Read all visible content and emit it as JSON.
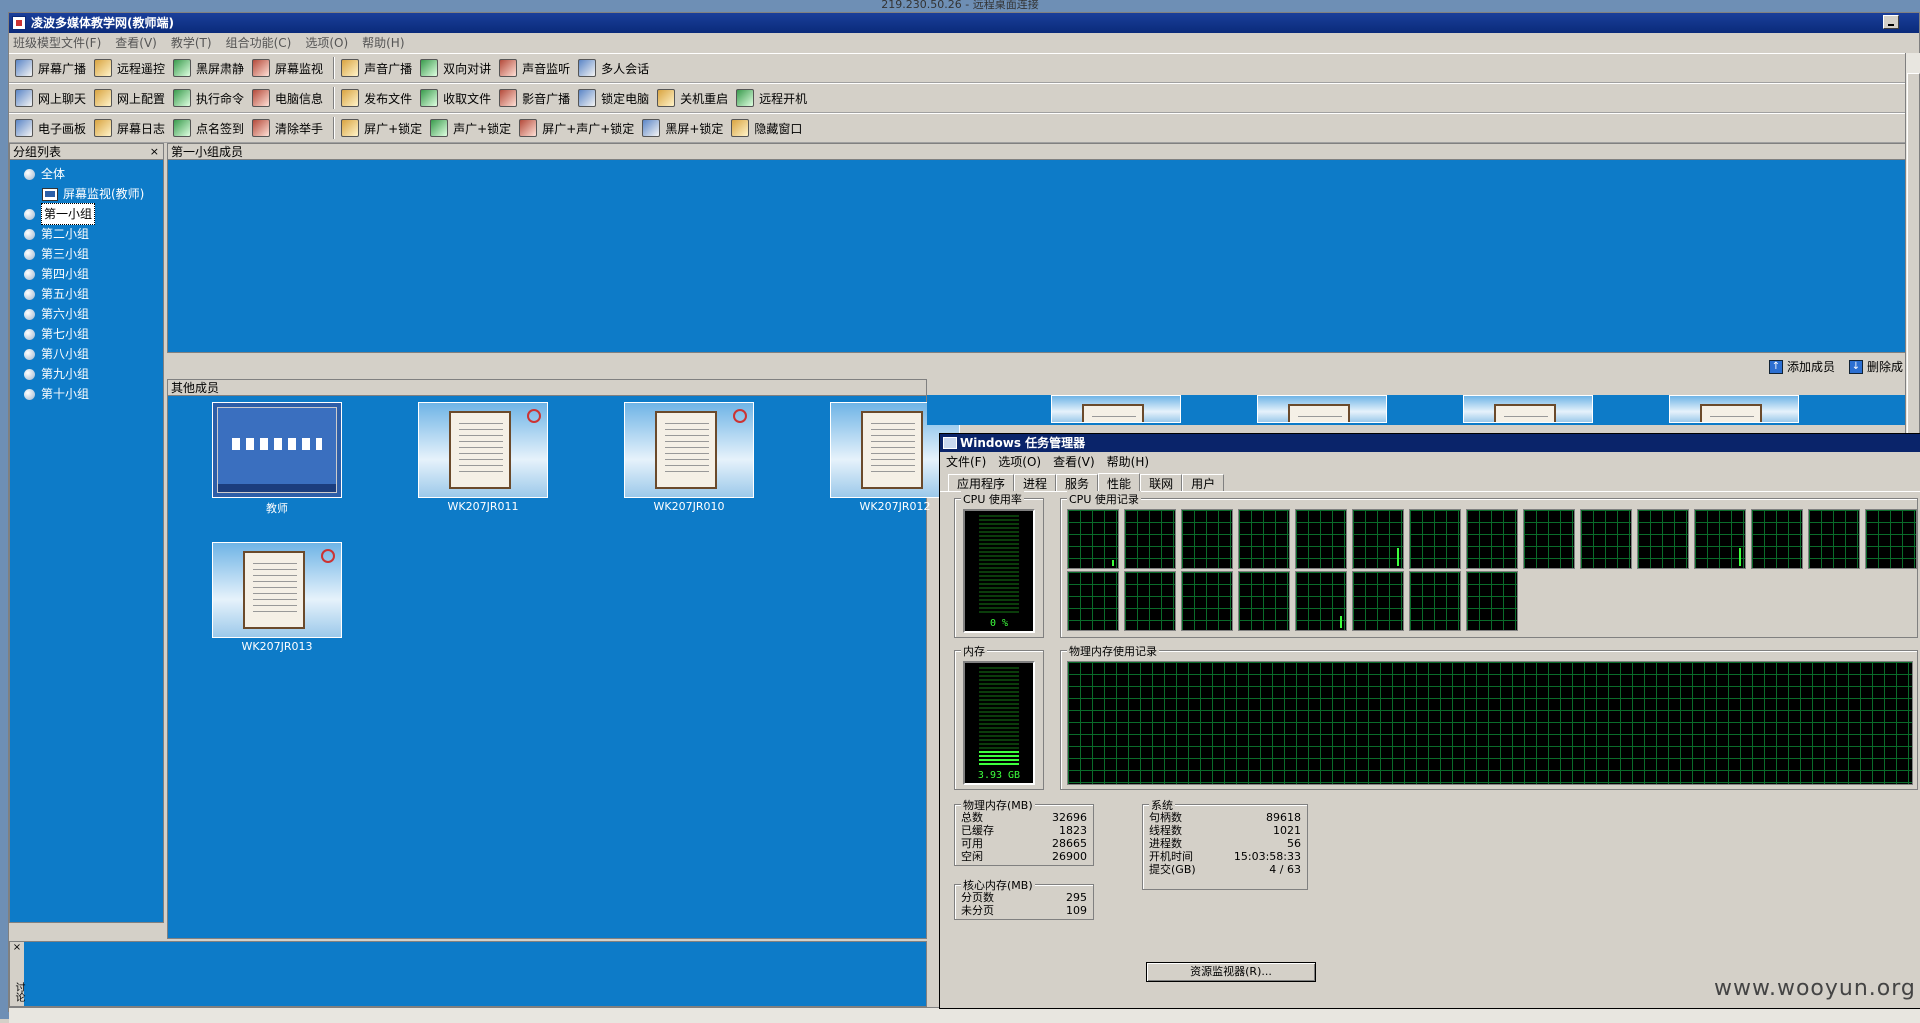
{
  "window": {
    "top_caption": "219.230.50.26 - 远程桌面连接",
    "title": "凌波多媒体教学网(教师端)"
  },
  "menu": [
    "班级模型文件(F)",
    "查看(V)",
    "教学(T)",
    "组合功能(C)",
    "选项(O)",
    "帮助(H)"
  ],
  "toolbar1": [
    "屏幕广播",
    "远程遥控",
    "黑屏肃静",
    "屏幕监视",
    "|",
    "声音广播",
    "双向对讲",
    "声音监听",
    "多人会话"
  ],
  "toolbar2": [
    "网上聊天",
    "网上配置",
    "执行命令",
    "电脑信息",
    "|",
    "发布文件",
    "收取文件",
    "影音广播",
    "锁定电脑",
    "关机重启",
    "远程开机"
  ],
  "toolbar3": [
    "电子画板",
    "屏幕日志",
    "点名签到",
    "清除举手",
    "|",
    "屏广+锁定",
    "声广+锁定",
    "屏广+声广+锁定",
    "黑屏+锁定",
    "隐藏窗口"
  ],
  "group_list": {
    "header": "分组列表",
    "close": "×",
    "all": "全体",
    "monitor_node": "屏幕监视(教师)",
    "groups": [
      "第一小组",
      "第二小组",
      "第三小组",
      "第四小组",
      "第五小组",
      "第六小组",
      "第七小组",
      "第八小组",
      "第九小组",
      "第十小组"
    ],
    "selected": "第一小组"
  },
  "group1": {
    "header": "第一小组成员"
  },
  "actions": {
    "add": "添加成员",
    "remove": "删除成"
  },
  "others": {
    "header": "其他成员",
    "members": [
      "教师",
      "WK207JR011",
      "WK207JR010",
      "WK207JR012",
      "WK207JR013"
    ]
  },
  "bottom": {
    "close": "×",
    "side": "讨论"
  },
  "taskmgr": {
    "title": "Windows 任务管理器",
    "menu": [
      "文件(F)",
      "选项(O)",
      "查看(V)",
      "帮助(H)"
    ],
    "tabs": [
      "应用程序",
      "进程",
      "服务",
      "性能",
      "联网",
      "用户"
    ],
    "active_tab": "性能",
    "cpu_label": "CPU 使用率",
    "cpu_value": "0 %",
    "cpu_history_label": "CPU 使用记录",
    "mem_label": "内存",
    "mem_value": "3.93 GB",
    "mem_history_label": "物理内存使用记录",
    "phys": {
      "label": "物理内存(MB)",
      "rows": [
        [
          "总数",
          "32696"
        ],
        [
          "已缓存",
          "1823"
        ],
        [
          "可用",
          "28665"
        ],
        [
          "空闲",
          "26900"
        ]
      ]
    },
    "kernel": {
      "label": "核心内存(MB)",
      "rows": [
        [
          "分页数",
          "295"
        ],
        [
          "未分页",
          "109"
        ]
      ]
    },
    "system": {
      "label": "系统",
      "rows": [
        [
          "句柄数",
          "89618"
        ],
        [
          "线程数",
          "1021"
        ],
        [
          "进程数",
          "56"
        ],
        [
          "开机时间",
          "15:03:58:33"
        ],
        [
          "提交(GB)",
          "4 / 63"
        ]
      ]
    },
    "resource_button": "资源监视器(R)..."
  },
  "watermark": "www.wooyun.org",
  "colors": {
    "pane_blue": "#0d7bc8",
    "title_blue": "#0a246a",
    "graph_green": "#3dff3d"
  }
}
